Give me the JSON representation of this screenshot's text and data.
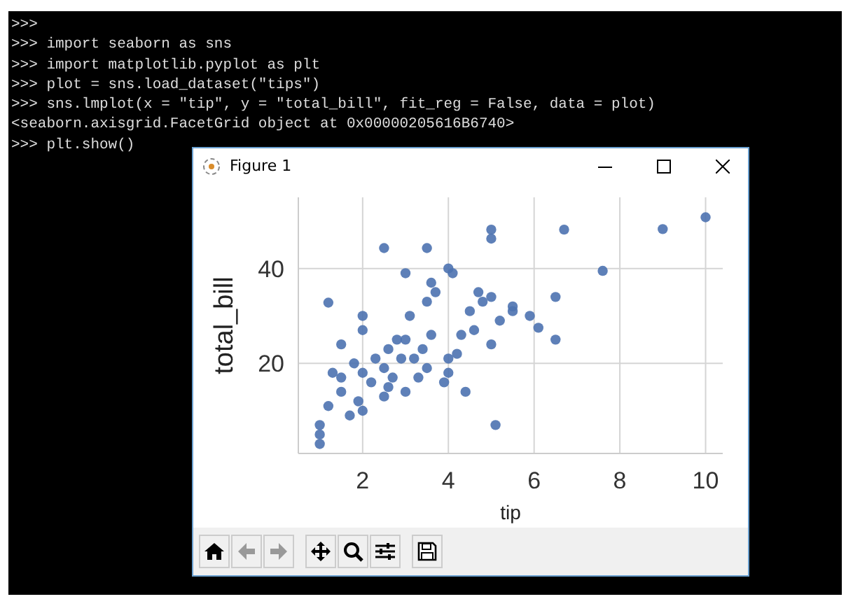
{
  "console": {
    "lines": [
      ">>>",
      ">>> import seaborn as sns",
      ">>> import matplotlib.pyplot as plt",
      ">>> plot = sns.load_dataset(\"tips\")",
      ">>> sns.lmplot(x = \"tip\", y = \"total_bill\", fit_reg = False, data = plot)",
      "<seaborn.axisgrid.FacetGrid object at 0x00000205616B6740>",
      ">>> plt.show()"
    ]
  },
  "figure_window": {
    "title": "Figure 1",
    "chart_data": {
      "type": "scatter",
      "grid": true,
      "xlabel": "tip",
      "ylabel": "total_bill",
      "xlim": [
        0.5,
        10.4
      ],
      "ylim": [
        1,
        55
      ],
      "xticks": [
        2,
        4,
        6,
        8,
        10
      ],
      "yticks": [
        20,
        40
      ],
      "x": [
        10,
        9,
        6.7,
        5,
        7.6,
        3.5,
        5,
        2.5,
        4,
        3,
        3.7,
        4.7,
        5,
        6.5,
        6.1,
        6.5,
        5.9,
        5.5,
        5.2,
        4.5,
        1.2,
        2,
        2,
        1.5,
        2.6,
        3,
        3.2,
        4,
        3.5,
        2.5,
        2,
        1.5,
        1.2,
        1.9,
        2.2,
        2.6,
        3.3,
        4,
        4.2,
        5,
        5.1,
        1,
        1,
        1,
        1.7,
        2,
        2.5,
        3,
        2.9,
        3.1,
        3.5,
        4.3,
        4.6,
        3.6,
        2.8,
        2.3,
        1.8,
        1.5,
        1.3,
        3.9,
        4.4,
        2.7,
        3.4,
        5.5,
        4.8,
        4.1,
        3.6
      ],
      "series": [
        {
          "color": "#4c72b0",
          "values": [
            50.8,
            48.3,
            48.2,
            48.2,
            39.5,
            44.3,
            46.3,
            44.3,
            40,
            39,
            35,
            35,
            34,
            34,
            27.5,
            25,
            30,
            32,
            29,
            31,
            32.8,
            30,
            27,
            24,
            23,
            25,
            21,
            21,
            19,
            19,
            18,
            14,
            11,
            12,
            16,
            15,
            17,
            18,
            22,
            24,
            7,
            7,
            3,
            5,
            9,
            10,
            13,
            14,
            21,
            30,
            33,
            26,
            27,
            26,
            25,
            21,
            20,
            17,
            18,
            16,
            14,
            17,
            23,
            31,
            33,
            39,
            37
          ]
        }
      ]
    },
    "toolbar": [
      {
        "kind": "home"
      },
      {
        "kind": "back"
      },
      {
        "kind": "forward"
      },
      {
        "kind": "pan"
      },
      {
        "kind": "zoom"
      },
      {
        "kind": "configure"
      },
      {
        "kind": "save"
      }
    ]
  }
}
